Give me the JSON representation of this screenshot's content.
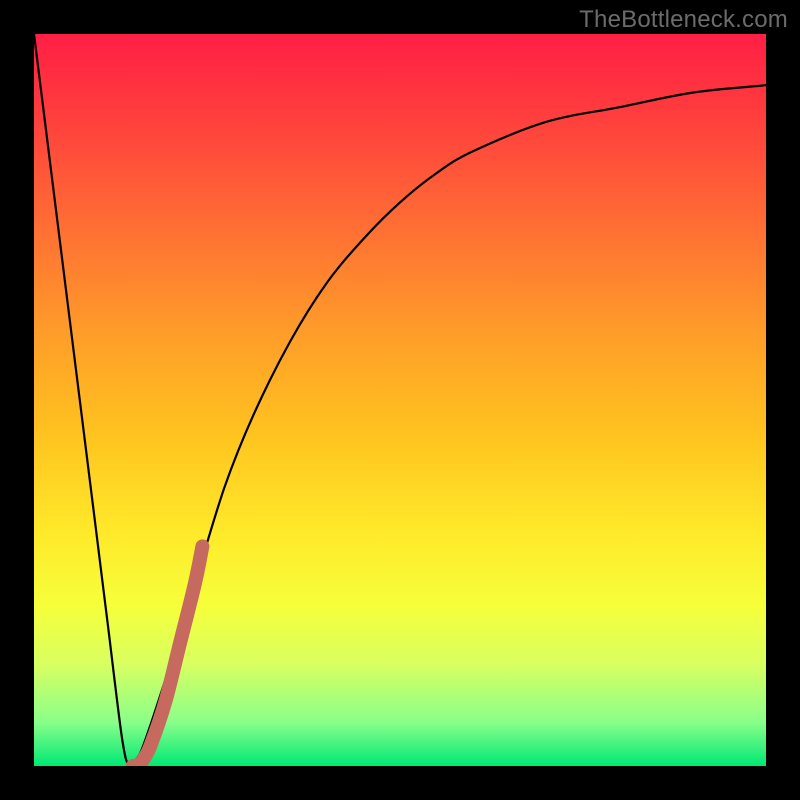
{
  "watermark": {
    "text": "TheBottleneck.com"
  },
  "colors": {
    "curve_stroke": "#000000",
    "accent_stroke": "#c66a5f",
    "gradient_stops": [
      "#ff1f45",
      "#ff3a3e",
      "#ff6a35",
      "#ff9a2a",
      "#ffc41f",
      "#ffe92a",
      "#f6ff3a",
      "#d9ff60",
      "#8aff8a",
      "#00e874"
    ]
  },
  "chart_data": {
    "type": "line",
    "title": "",
    "xlabel": "",
    "ylabel": "",
    "xlim": [
      0,
      100
    ],
    "ylim": [
      0,
      100
    ],
    "series": [
      {
        "name": "curve",
        "x": [
          0,
          5,
          8,
          10,
          12,
          13,
          14,
          15,
          18,
          22,
          26,
          30,
          35,
          40,
          45,
          50,
          55,
          60,
          70,
          80,
          90,
          100
        ],
        "values": [
          100,
          60,
          36,
          20,
          4,
          0,
          1,
          3,
          12,
          25,
          38,
          48,
          58,
          66,
          72,
          77,
          81,
          84,
          88,
          90,
          92,
          93
        ]
      },
      {
        "name": "accent_segment",
        "x": [
          13.5,
          14,
          15,
          16,
          18,
          20,
          22,
          23
        ],
        "values": [
          0,
          0,
          1,
          3,
          9,
          17,
          25,
          30
        ]
      }
    ]
  }
}
